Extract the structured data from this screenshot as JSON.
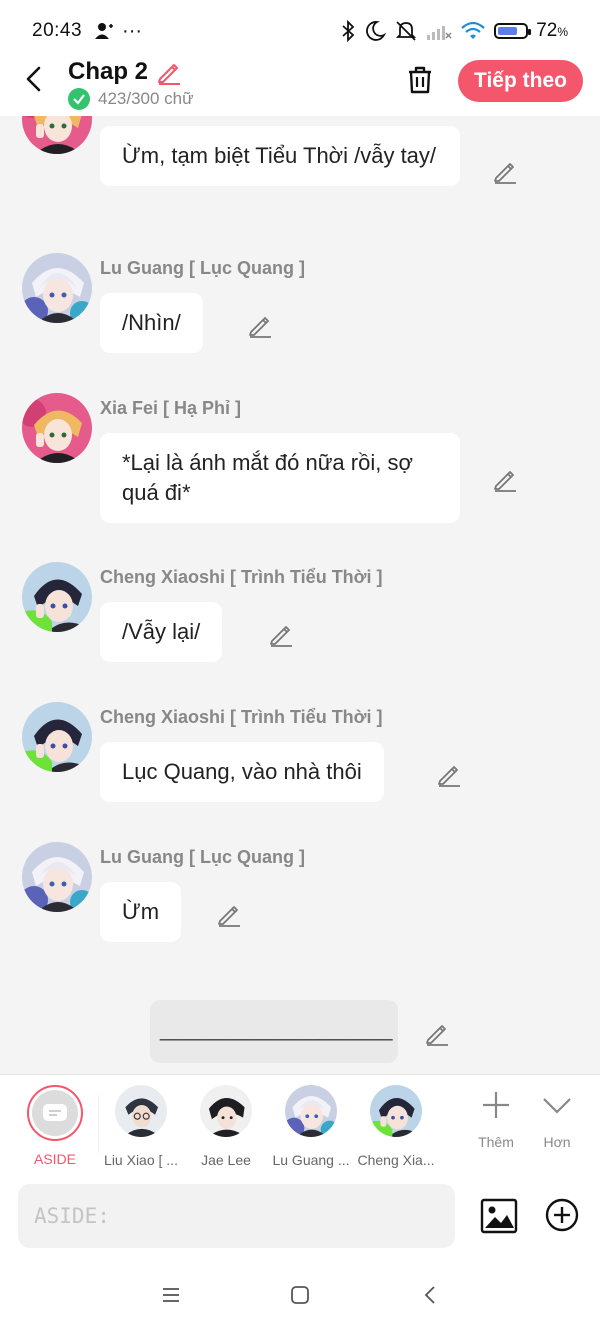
{
  "status": {
    "time": "20:43",
    "dots": "···",
    "battery": "72",
    "battery_unit": "%",
    "battery_level": 0.72
  },
  "header": {
    "title": "Chap 2",
    "word_count": "423/300 chữ",
    "next_label": "Tiếp theo"
  },
  "messages": [
    {
      "speaker": "",
      "text": "Ừm, tạm biệt Tiểu Thời /vẫy tay/"
    },
    {
      "speaker": "Lu Guang [ Lục Quang ]",
      "text": "/Nhìn/"
    },
    {
      "speaker": "Xia Fei [ Hạ Phỉ ]",
      "text": "*Lại là ánh mắt đó nữa rồi, sợ quá đi*"
    },
    {
      "speaker": "Cheng Xiaoshi [ Trình Tiểu Thời ]",
      "text": "/Vẫy lại/"
    },
    {
      "speaker": "Cheng Xiaoshi [ Trình Tiểu Thời ]",
      "text": "Lục Quang, vào nhà thôi"
    },
    {
      "speaker": "Lu Guang [ Lục Quang ]",
      "text": "Ừm"
    },
    {
      "speaker": "",
      "text": "___________________"
    }
  ],
  "characters": [
    {
      "name": "ASIDE"
    },
    {
      "name": "Liu Xiao [ ..."
    },
    {
      "name": "Jae Lee"
    },
    {
      "name": "Lu Guang ..."
    },
    {
      "name": "Cheng Xia..."
    }
  ],
  "tools": {
    "add_label": "Thêm",
    "more_label": "Hơn"
  },
  "input": {
    "placeholder": "ASIDE:"
  },
  "colors": {
    "accent": "#f4566c",
    "check": "#33c26e",
    "background": "#f4f4f4"
  },
  "icons": [
    "back-arrow-icon",
    "pencil-icon",
    "check-icon",
    "trash-icon",
    "plus-icon",
    "chevron-down-icon",
    "image-icon",
    "plus-circle-icon",
    "menu-icon",
    "home-square-icon",
    "back-triangle-icon"
  ]
}
